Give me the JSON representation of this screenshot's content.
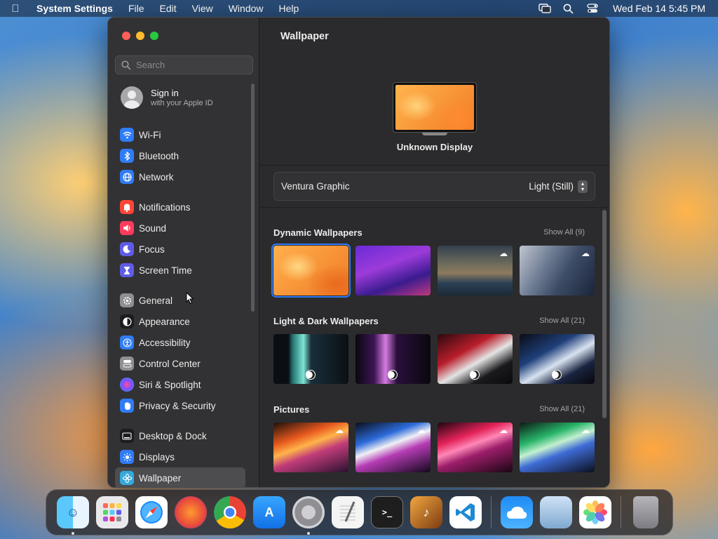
{
  "menubar": {
    "app_name": "System Settings",
    "menus": [
      "File",
      "Edit",
      "View",
      "Window",
      "Help"
    ],
    "clock": "Wed Feb 14  5:45 PM"
  },
  "sidebar": {
    "search_placeholder": "Search",
    "signin": {
      "title": "Sign in",
      "subtitle": "with your Apple ID"
    },
    "items": [
      {
        "label": "Wi-Fi",
        "icon": "wifi-icon",
        "color": "#2f7cf6"
      },
      {
        "label": "Bluetooth",
        "icon": "bluetooth-icon",
        "color": "#2f7cf6"
      },
      {
        "label": "Network",
        "icon": "globe-icon",
        "color": "#2f7cf6"
      },
      {
        "label": "Notifications",
        "icon": "bell-icon",
        "color": "#ff4538"
      },
      {
        "label": "Sound",
        "icon": "speaker-icon",
        "color": "#ff3b5c"
      },
      {
        "label": "Focus",
        "icon": "moon-icon",
        "color": "#5e5ce6"
      },
      {
        "label": "Screen Time",
        "icon": "hourglass-icon",
        "color": "#5e5ce6"
      },
      {
        "label": "General",
        "icon": "gear-icon",
        "color": "#8e8e93"
      },
      {
        "label": "Appearance",
        "icon": "appearance-icon",
        "color": "#1c1c1e"
      },
      {
        "label": "Accessibility",
        "icon": "accessibility-icon",
        "color": "#2f7cf6"
      },
      {
        "label": "Control Center",
        "icon": "control-center-icon",
        "color": "#8e8e93"
      },
      {
        "label": "Siri & Spotlight",
        "icon": "siri-icon",
        "color": "#b040e0"
      },
      {
        "label": "Privacy & Security",
        "icon": "hand-icon",
        "color": "#2f7cf6"
      },
      {
        "label": "Desktop & Dock",
        "icon": "dock-icon",
        "color": "#1c1c1e"
      },
      {
        "label": "Displays",
        "icon": "sun-icon",
        "color": "#2f7cf6"
      },
      {
        "label": "Wallpaper",
        "icon": "wallpaper-icon",
        "color": "#34aadc"
      }
    ]
  },
  "content": {
    "title": "Wallpaper",
    "display_name": "Unknown Display",
    "current_wallpaper": "Ventura Graphic",
    "appearance_mode": "Light (Still)",
    "sections": [
      {
        "title": "Dynamic Wallpapers",
        "show_all": "Show All (9)"
      },
      {
        "title": "Light & Dark Wallpapers",
        "show_all": "Show All (21)"
      },
      {
        "title": "Pictures",
        "show_all": "Show All (21)"
      }
    ]
  },
  "dock": {
    "apps": [
      "Finder",
      "Launchpad",
      "Safari",
      "Firefox",
      "Google Chrome",
      "App Store",
      "System Settings",
      "TextEdit",
      "Terminal",
      "GarageBand",
      "Visual Studio Code",
      "Weather",
      "Preview",
      "Photos",
      "Trash"
    ]
  }
}
